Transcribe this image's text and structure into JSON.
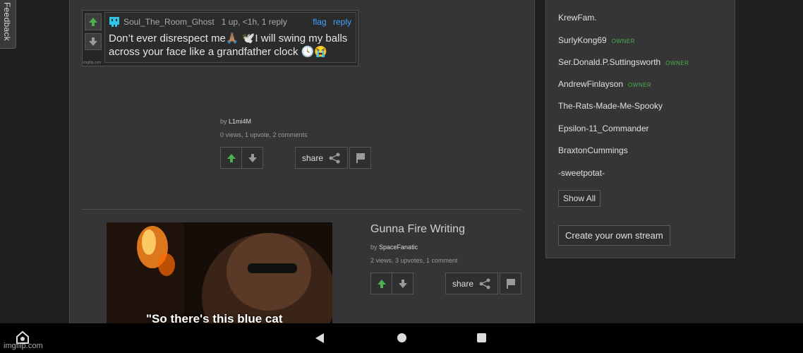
{
  "feedback": {
    "label": "Feedback"
  },
  "comment": {
    "username": "Soul_The_Room_Ghost",
    "meta": "1 up, <1h, 1 reply",
    "flag": "flag",
    "reply": "reply",
    "line1": "Don’t ever disrespect me🙏🏽 🕊️I will swing my balls",
    "line2": "across your face like a grandfather clock 🕓😭",
    "watermark": "imgflip.com"
  },
  "post1": {
    "by_prefix": "by",
    "author": "L1mi4M",
    "stats": "0 views, 1 upvote, 2 comments",
    "share": "share"
  },
  "post2": {
    "title": "Gunna Fire Writing",
    "by_prefix": "by",
    "author": "SpaceFanatic",
    "stats": "2 views, 3 upvotes, 1 comment",
    "share": "share",
    "caption": "\"So there's this blue cat"
  },
  "sidebar": {
    "members": [
      {
        "name": "KrewFam.",
        "badge": ""
      },
      {
        "name": "SurlyKong69",
        "badge": "OWNER"
      },
      {
        "name": "Ser.Donald.P.Suttingsworth",
        "badge": "OWNER"
      },
      {
        "name": "AndrewFinlayson",
        "badge": "OWNER"
      },
      {
        "name": "The-Rats-Made-Me-Spooky",
        "badge": ""
      },
      {
        "name": "Epsilon-11_Commander",
        "badge": ""
      },
      {
        "name": "BraxtonCummings",
        "badge": ""
      },
      {
        "name": "-sweetpotat-",
        "badge": ""
      }
    ],
    "show_all": "Show All",
    "create_stream": "Create your own stream"
  },
  "navbar": {
    "watermark": "imgflip.com"
  },
  "colors": {
    "upvote": "#4caf50",
    "link": "#3ea3ff",
    "owner": "#4caf50"
  }
}
